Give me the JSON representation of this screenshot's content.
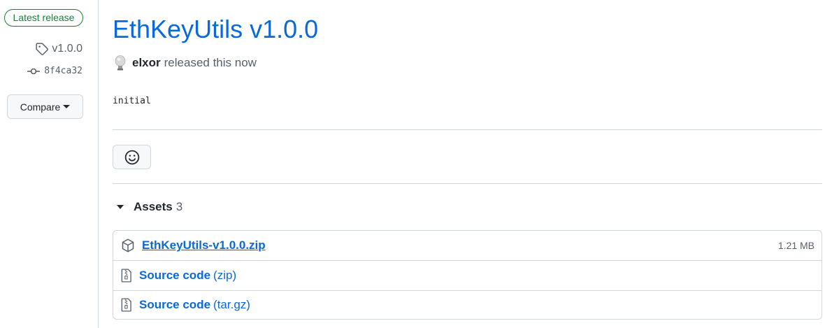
{
  "sidebar": {
    "badge": "Latest release",
    "tag": "v1.0.0",
    "commit": "8f4ca32",
    "compare_label": "Compare"
  },
  "release": {
    "title": "EthKeyUtils v1.0.0",
    "author": "elxor",
    "released_text": "released this now",
    "body": "initial"
  },
  "assets": {
    "label": "Assets",
    "count": "3",
    "items": [
      {
        "name": "EthKeyUtils-v1.0.0.zip",
        "size": "1.21 MB",
        "icon": "package-icon"
      },
      {
        "name": "Source code",
        "ext": "(zip)",
        "icon": "file-zip-icon"
      },
      {
        "name": "Source code",
        "ext": "(tar.gz)",
        "icon": "file-zip-icon"
      }
    ]
  },
  "colors": {
    "link": "#0969da",
    "success": "#1a7f37",
    "border": "#d0d7de",
    "muted": "#57606a"
  }
}
